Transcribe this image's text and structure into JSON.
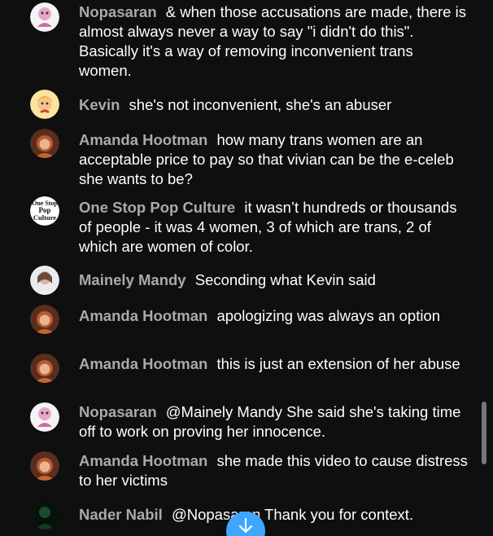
{
  "messages": [
    {
      "author": "Nopasaran",
      "text": "& when those accusations are made, there is almost always never a way to say \"i didn't do this\". Basically it's a way of removing inconvenient trans women.",
      "avatar": "cartoon-avatar"
    },
    {
      "author": "Kevin",
      "text": "she's not inconvenient, she's an abuser",
      "avatar": "cartoon-avatar"
    },
    {
      "author": "Amanda Hootman",
      "text": "how many trans women are an acceptable price to pay so that vivian can be the e-celeb she wants to be?",
      "avatar": "photo-avatar"
    },
    {
      "author": "One Stop Pop Culture",
      "text": "it wasn’t hundreds or thousands of people - it was 4 women, 3 of which are trans, 2 of which are women of color.",
      "avatar": "logo-avatar",
      "avatar_text": [
        "One Stop",
        "Pop",
        "Culture"
      ]
    },
    {
      "author": "Mainely Mandy",
      "text": "Seconding what Kevin said",
      "avatar": "photo-avatar"
    },
    {
      "author": "Amanda Hootman",
      "text": "apologizing was always an option",
      "avatar": "photo-avatar"
    },
    {
      "author": "Amanda Hootman",
      "text": "this is just an extension of her abuse",
      "avatar": "photo-avatar"
    },
    {
      "author": "Nopasaran",
      "text": "@Mainely Mandy She said she's taking time off to work on proving her innocence.",
      "avatar": "cartoon-avatar"
    },
    {
      "author": "Amanda Hootman",
      "text": "she made this video to cause distress to her victims",
      "avatar": "photo-avatar"
    },
    {
      "author": "Nader Nabil",
      "text": "@Nopasaran Thank you for context.",
      "avatar": "photo-avatar"
    }
  ],
  "colors": {
    "background": "#0f0f0f",
    "author": "#aaaaaa",
    "message_text": "#ffffff",
    "accent": "#3ea6ff"
  },
  "controls": {
    "scroll_down_icon": "arrow-down-icon"
  }
}
